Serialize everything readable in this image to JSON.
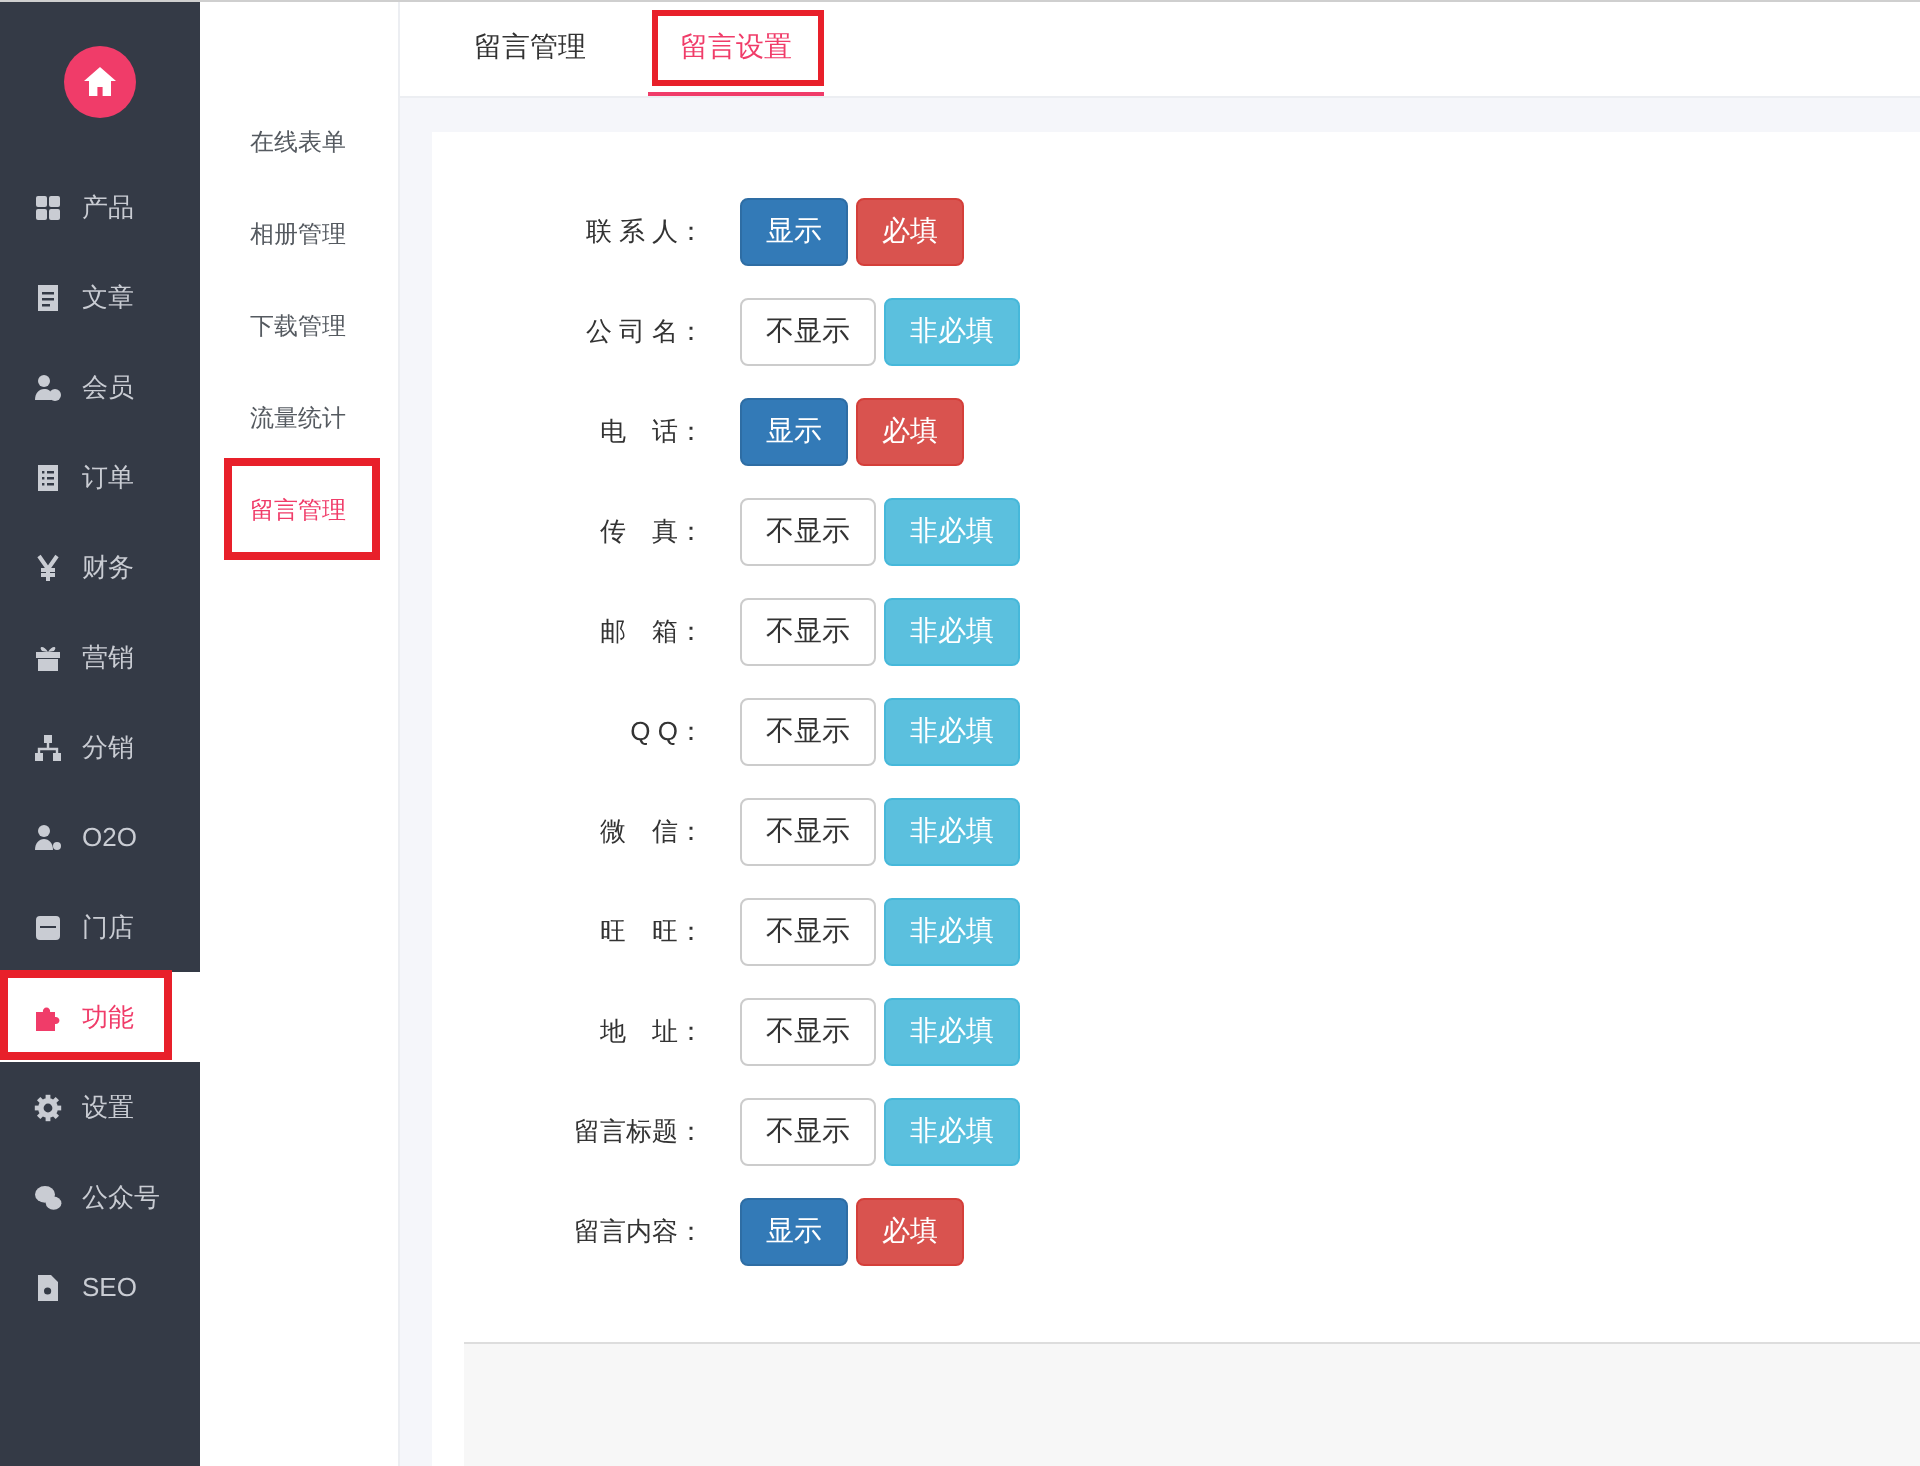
{
  "sidebar": {
    "items": [
      {
        "label": "产品",
        "selected": false,
        "highlighted": false
      },
      {
        "label": "文章",
        "selected": false,
        "highlighted": false
      },
      {
        "label": "会员",
        "selected": false,
        "highlighted": false
      },
      {
        "label": "订单",
        "selected": false,
        "highlighted": false
      },
      {
        "label": "财务",
        "selected": false,
        "highlighted": false
      },
      {
        "label": "营销",
        "selected": false,
        "highlighted": false
      },
      {
        "label": "分销",
        "selected": false,
        "highlighted": false
      },
      {
        "label": "O2O",
        "selected": false,
        "highlighted": false
      },
      {
        "label": "门店",
        "selected": false,
        "highlighted": false
      },
      {
        "label": "功能",
        "selected": true,
        "highlighted": true
      },
      {
        "label": "设置",
        "selected": false,
        "highlighted": false
      },
      {
        "label": "公众号",
        "selected": false,
        "highlighted": false
      },
      {
        "label": "SEO",
        "selected": false,
        "highlighted": false
      }
    ]
  },
  "subnav": {
    "items": [
      {
        "label": "在线表单",
        "selected": false,
        "highlighted": false
      },
      {
        "label": "相册管理",
        "selected": false,
        "highlighted": false
      },
      {
        "label": "下载管理",
        "selected": false,
        "highlighted": false
      },
      {
        "label": "流量统计",
        "selected": false,
        "highlighted": false
      },
      {
        "label": "留言管理",
        "selected": true,
        "highlighted": true
      }
    ]
  },
  "tabs": [
    {
      "label": "留言管理",
      "selected": false,
      "highlighted": false
    },
    {
      "label": "留言设置",
      "selected": true,
      "highlighted": true
    }
  ],
  "fields": [
    {
      "label": "联 系 人：",
      "display": {
        "label": "显示",
        "on": true
      },
      "required": {
        "label": "必填",
        "on": true
      }
    },
    {
      "label": "公 司 名：",
      "display": {
        "label": "不显示",
        "on": false
      },
      "required": {
        "label": "非必填",
        "on": false
      }
    },
    {
      "label": "电　话：",
      "display": {
        "label": "显示",
        "on": true
      },
      "required": {
        "label": "必填",
        "on": true
      }
    },
    {
      "label": "传　真：",
      "display": {
        "label": "不显示",
        "on": false
      },
      "required": {
        "label": "非必填",
        "on": false
      }
    },
    {
      "label": "邮　箱：",
      "display": {
        "label": "不显示",
        "on": false
      },
      "required": {
        "label": "非必填",
        "on": false
      }
    },
    {
      "label": "Q Q：",
      "display": {
        "label": "不显示",
        "on": false
      },
      "required": {
        "label": "非必填",
        "on": false
      }
    },
    {
      "label": "微　信：",
      "display": {
        "label": "不显示",
        "on": false
      },
      "required": {
        "label": "非必填",
        "on": false
      }
    },
    {
      "label": "旺　旺：",
      "display": {
        "label": "不显示",
        "on": false
      },
      "required": {
        "label": "非必填",
        "on": false
      }
    },
    {
      "label": "地　址：",
      "display": {
        "label": "不显示",
        "on": false
      },
      "required": {
        "label": "非必填",
        "on": false
      }
    },
    {
      "label": "留言标题：",
      "display": {
        "label": "不显示",
        "on": false
      },
      "required": {
        "label": "非必填",
        "on": false
      }
    },
    {
      "label": "留言内容：",
      "display": {
        "label": "显示",
        "on": true
      },
      "required": {
        "label": "必填",
        "on": true
      }
    }
  ]
}
